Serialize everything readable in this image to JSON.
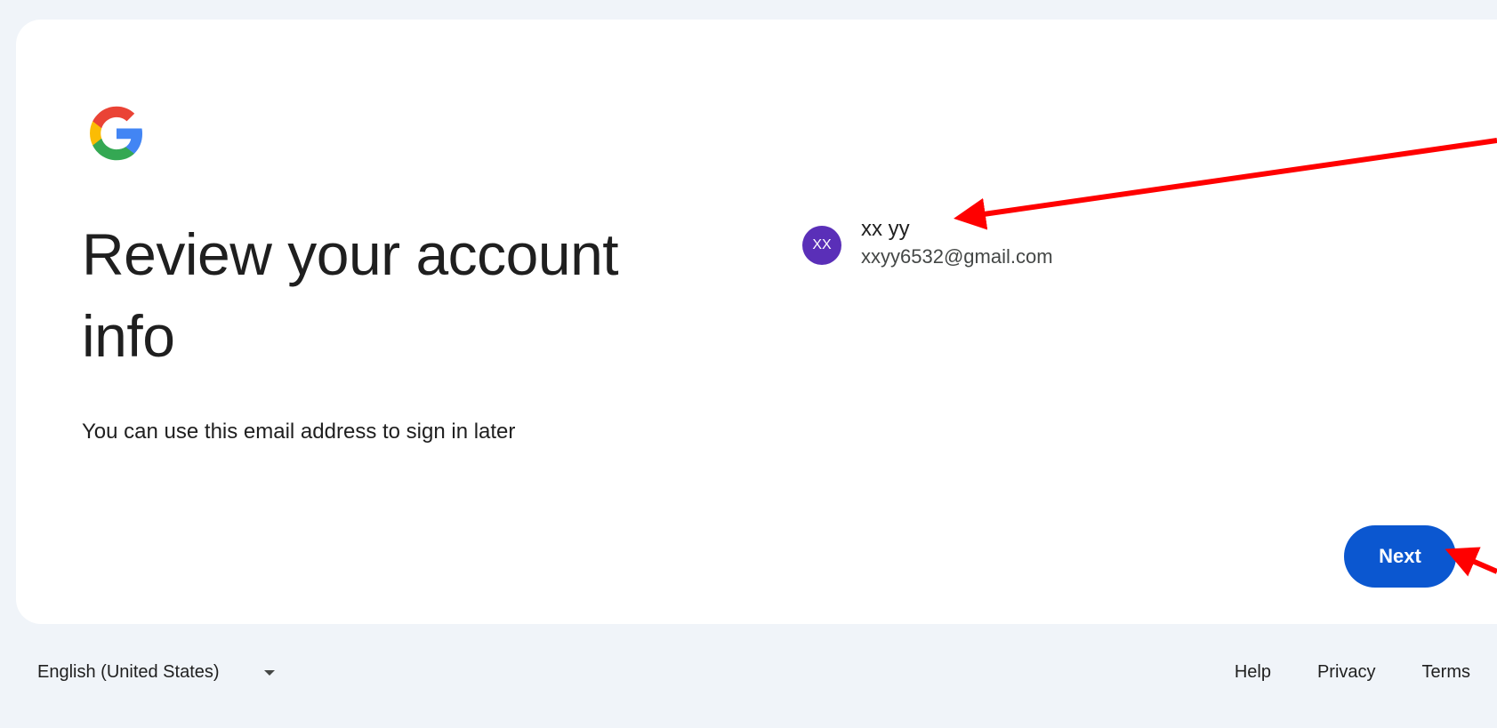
{
  "logo": {
    "icon": "google-g-icon",
    "colors": [
      "#ea4335",
      "#fbbc04",
      "#34a853",
      "#4285f4"
    ]
  },
  "header": {
    "title": "Review your account info",
    "subtitle": "You can use this email address to sign in later"
  },
  "account": {
    "avatar_initials": "XX",
    "name": "xx yy",
    "email": "xxyy6532@gmail.com",
    "avatar_color": "#5a2fb8"
  },
  "actions": {
    "next_label": "Next",
    "accent": "#0b57d0"
  },
  "footer": {
    "language": "English (United States)",
    "links": [
      "Help",
      "Privacy",
      "Terms"
    ]
  },
  "annotations": {
    "arrow_color": "#ff0000"
  }
}
